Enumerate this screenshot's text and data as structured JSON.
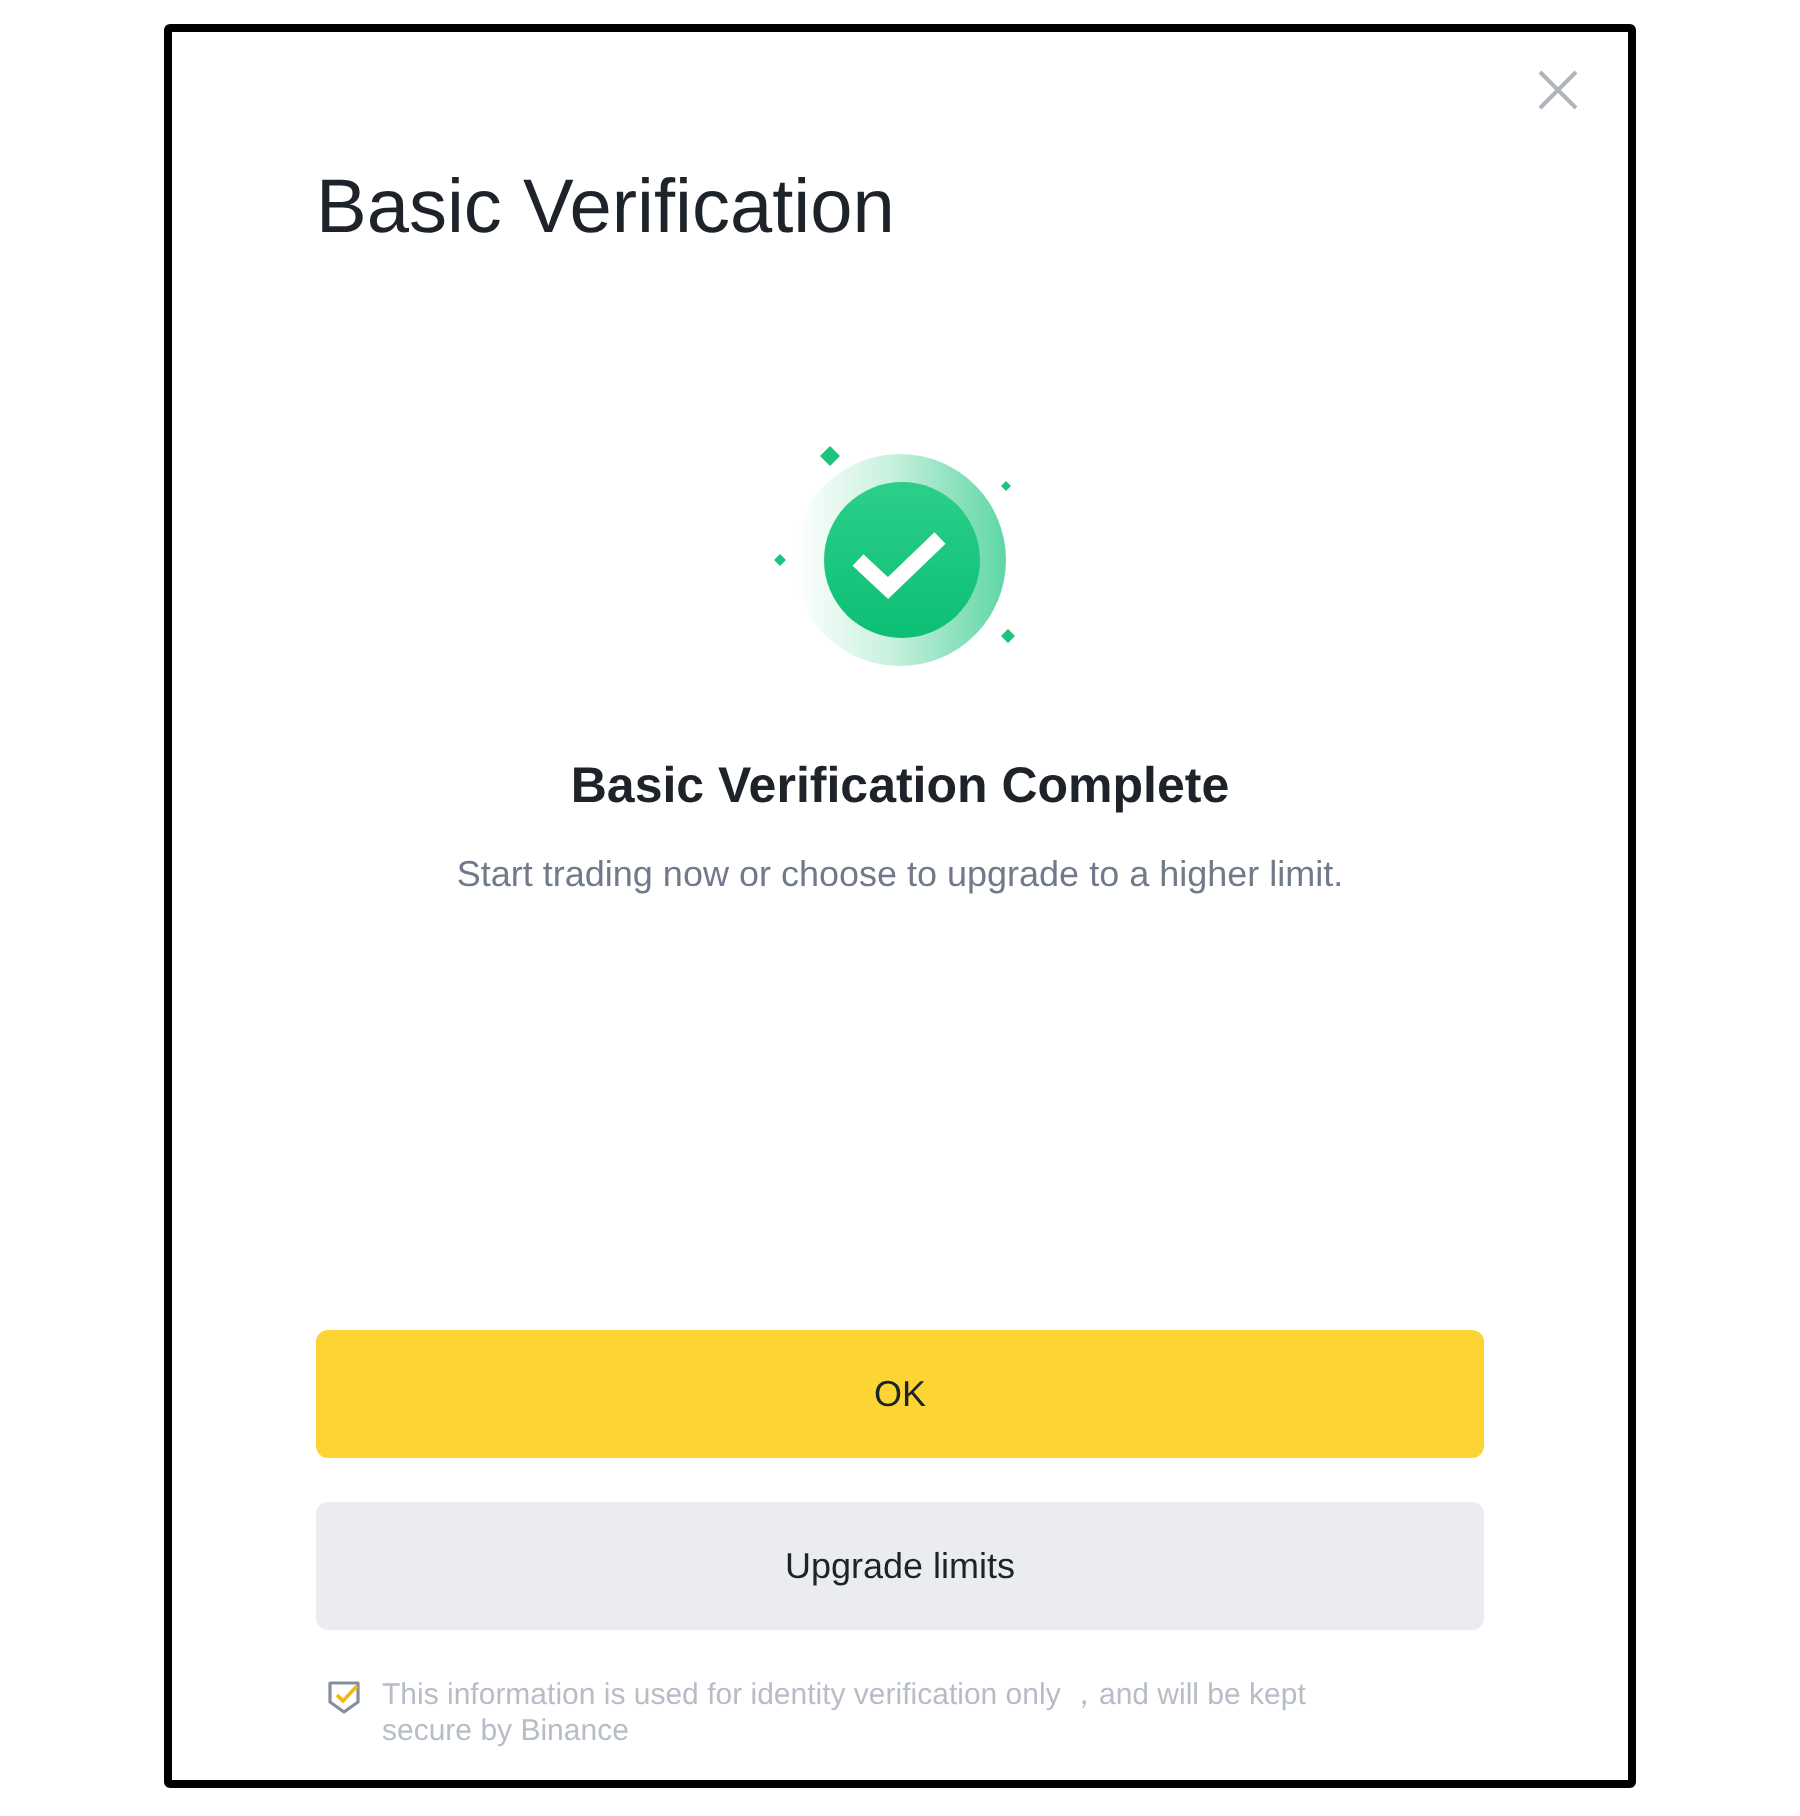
{
  "dialog": {
    "title": "Basic Verification"
  },
  "status": {
    "heading": "Basic Verification Complete",
    "message": "Start trading now or choose to upgrade to a higher limit."
  },
  "buttons": [
    {
      "label": "OK",
      "kind": "primary"
    },
    {
      "label": "Upgrade limits",
      "kind": "secondary"
    }
  ],
  "footer_note": "This information is used for identity verification only ，and will be kept secure by Binance"
}
